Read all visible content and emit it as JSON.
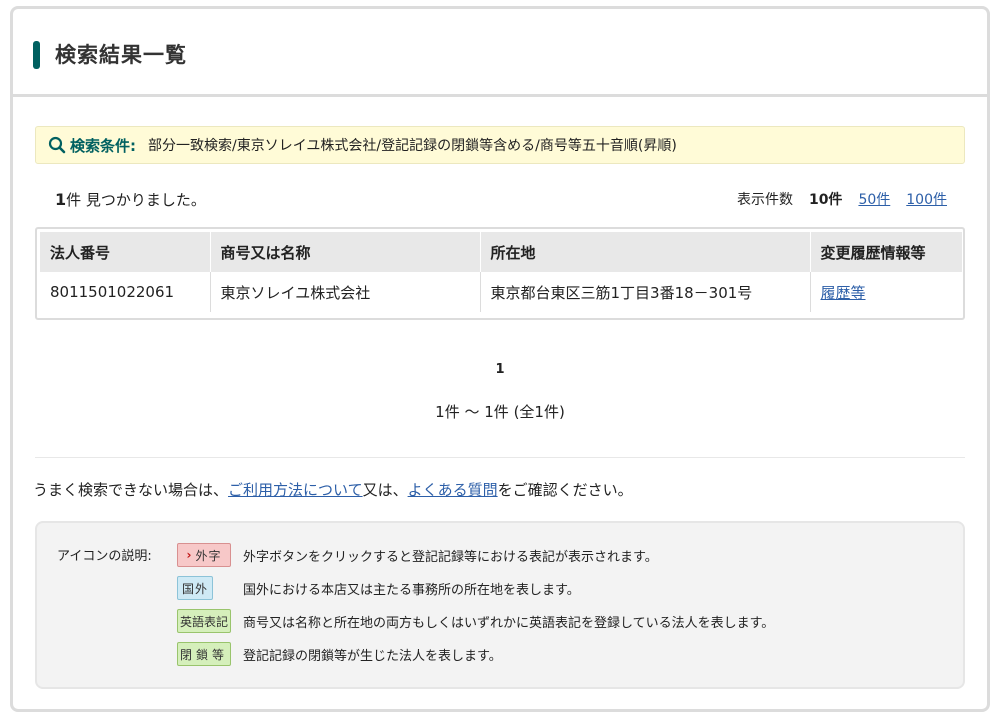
{
  "header": {
    "title": "検索結果一覧"
  },
  "condition": {
    "label": "検索条件:",
    "text": "部分一致検索/東京ソレイユ株式会社/登記記録の閉鎖等含める/商号等五十音順(昇順)"
  },
  "results": {
    "count": "1",
    "found_suffix": "件 見つかりました。",
    "per_page_label": "表示件数",
    "per_page_options": [
      "10件",
      "50件",
      "100件"
    ],
    "selected_per_page": "10件"
  },
  "table": {
    "headers": [
      "法人番号",
      "商号又は名称",
      "所在地",
      "変更履歴情報等"
    ],
    "rows": [
      {
        "number": "8011501022061",
        "name": "東京ソレイユ株式会社",
        "address": "東京都台東区三筋1丁目3番18－301号",
        "history": "履歴等"
      }
    ]
  },
  "pagination": {
    "current_page": "1",
    "range": "1件 ～ 1件 (全1件)"
  },
  "help": {
    "prefix": "うまく検索できない場合は、",
    "link1": "ご利用方法について",
    "middle": "又は、",
    "link2": "よくある質問",
    "suffix": "をご確認ください。"
  },
  "legend": {
    "title": "アイコンの説明:",
    "items": [
      {
        "badge": "外字",
        "text": "外字ボタンをクリックすると登記記録等における表記が表示されます。"
      },
      {
        "badge": "国外",
        "text": "国外における本店又は主たる事務所の所在地を表します。"
      },
      {
        "badge": "英語表記",
        "text": "商号又は名称と所在地の両方もしくはいずれかに英語表記を登録している法人を表します。"
      },
      {
        "badge": "閉鎖等",
        "text": "登記記録の閉鎖等が生じた法人を表します。"
      }
    ]
  },
  "colors": {
    "accent": "#006060",
    "link": "#2d5fa8",
    "condition_bg": "#fffbd7"
  }
}
